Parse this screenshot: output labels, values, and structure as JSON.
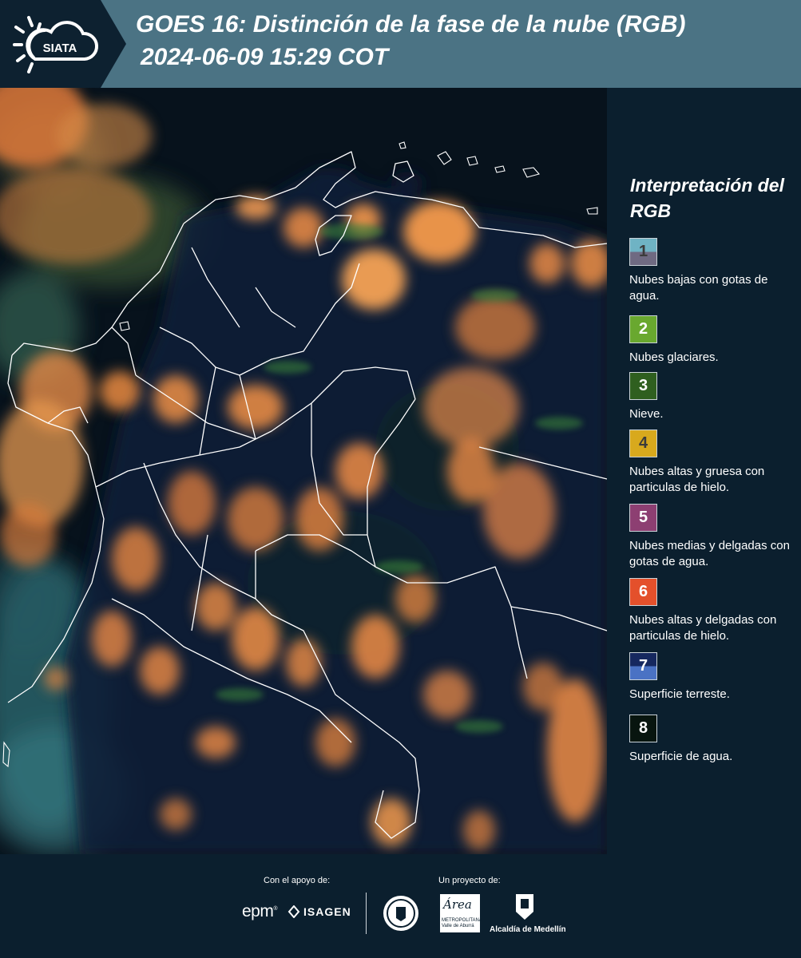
{
  "header": {
    "logo_text": "SIATA",
    "title_line1": "GOES 16: Distinción de la fase de la nube (RGB)",
    "title_line2": "2024-06-09 15:29 COT"
  },
  "legend": {
    "title": "Interpretación del RGB",
    "items": [
      {
        "number": "1",
        "label": "Nubes bajas con gotas de agua.",
        "color_top": "#6fb3c4",
        "color_bottom": "#6f6a82"
      },
      {
        "number": "2",
        "label": "Nubes glaciares.",
        "color": "#69a82f"
      },
      {
        "number": "3",
        "label": "Nieve.",
        "color": "#2f5f1f"
      },
      {
        "number": "4",
        "label": "Nubes altas y gruesa con particulas de hielo.",
        "color": "#d8a91d"
      },
      {
        "number": "5",
        "label": "Nubes medias y delgadas con gotas de agua.",
        "color": "#8d3f72"
      },
      {
        "number": "6",
        "label": "Nubes altas y delgadas con particulas de hielo.",
        "color": "#e4502b"
      },
      {
        "number": "7",
        "label": "Superficie terreste.",
        "color_top": "#16285f",
        "color_bottom": "#4a72c4"
      },
      {
        "number": "8",
        "label": "Superficie de agua.",
        "color": "#08150f"
      }
    ]
  },
  "footer": {
    "support_label": "Con el apoyo de:",
    "project_label": "Un proyecto de:",
    "sponsor_1": "epm",
    "sponsor_2": "ISAGEN",
    "partner_area": "Área",
    "partner_area_sub": "METROPOLITANA Valle de Aburrá",
    "partner_alcaldia": "Alcaldía de Medellín"
  }
}
